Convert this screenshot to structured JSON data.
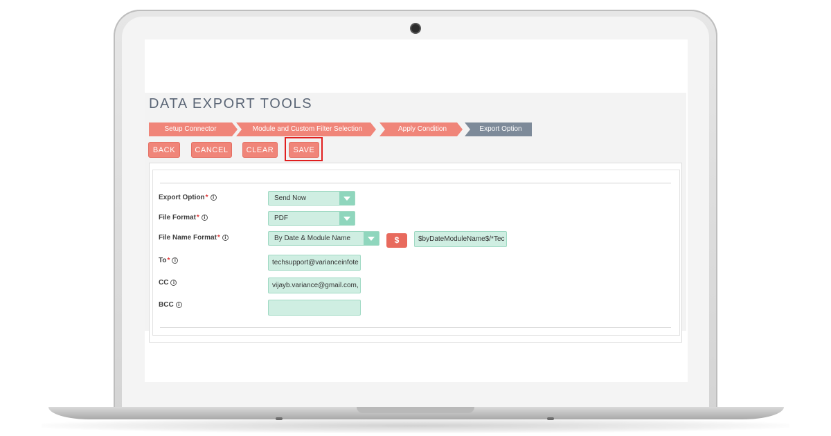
{
  "page": {
    "title": "DATA EXPORT TOOLS"
  },
  "steps": [
    {
      "label": "Setup Connector"
    },
    {
      "label": "Module and Custom Filter Selection"
    },
    {
      "label": "Apply Condition"
    },
    {
      "label": "Export Option"
    }
  ],
  "toolbar": {
    "back": "BACK",
    "cancel": "CANCEL",
    "clear": "CLEAR",
    "save": "SAVE"
  },
  "form": {
    "export_option": {
      "label": "Export Option",
      "required": "*",
      "value": "Send Now"
    },
    "file_format": {
      "label": "File Format",
      "required": "*",
      "value": "PDF"
    },
    "file_name_format": {
      "label": "File Name Format",
      "required": "*",
      "value": "By Date & Module Name",
      "button": "$",
      "pattern": "$byDateModuleName$/*Tec"
    },
    "to": {
      "label": "To",
      "required": "*",
      "value": "techsupport@varianceinfote"
    },
    "cc": {
      "label": "CC",
      "value": "vijayb.variance@gmail.com, k"
    },
    "bcc": {
      "label": "BCC",
      "value": ""
    }
  },
  "colors": {
    "step_done": "#f08579",
    "step_active": "#7d8a99",
    "button": "#f08579",
    "field_bg": "#cfeee2",
    "highlight": "#e01e1e"
  },
  "icons": {
    "info": "info-icon",
    "caret": "caret-down-icon"
  }
}
